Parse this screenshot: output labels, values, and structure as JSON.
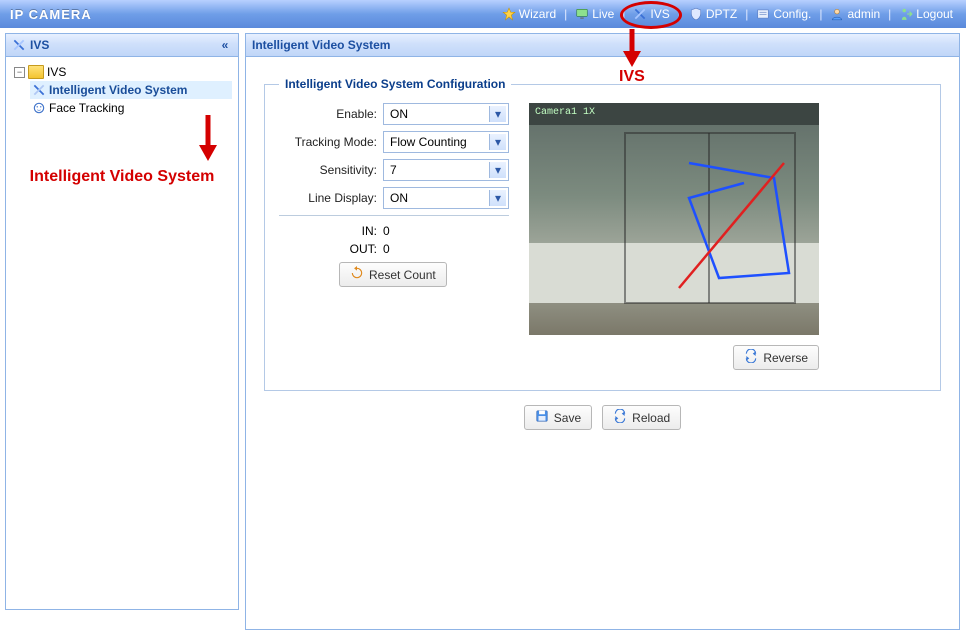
{
  "header": {
    "title": "IP CAMERA",
    "nav": {
      "wizard": "Wizard",
      "live": "Live",
      "ivs": "IVS",
      "dptz": "DPTZ",
      "config": "Config.",
      "admin": "admin",
      "logout": "Logout"
    }
  },
  "sidebar": {
    "panel_title": "IVS",
    "root": "IVS",
    "items": [
      {
        "label": "Intelligent Video System",
        "selected": true
      },
      {
        "label": "Face Tracking",
        "selected": false
      }
    ]
  },
  "main": {
    "panel_title": "Intelligent Video System",
    "fieldset_title": "Intelligent Video System Configuration",
    "form": {
      "enable_label": "Enable:",
      "enable_value": "ON",
      "tracking_label": "Tracking Mode:",
      "tracking_value": "Flow Counting",
      "sensitivity_label": "Sensitivity:",
      "sensitivity_value": "7",
      "line_display_label": "Line Display:",
      "line_display_value": "ON",
      "in_label": "IN:",
      "in_value": "0",
      "out_label": "OUT:",
      "out_value": "0",
      "reset_btn": "Reset Count"
    },
    "camera_label": "Camera1 1X",
    "reverse_btn": "Reverse",
    "save_btn": "Save",
    "reload_btn": "Reload"
  },
  "annotations": {
    "ivs_caption": "IVS",
    "sidebar_caption": "Intelligent Video System"
  }
}
